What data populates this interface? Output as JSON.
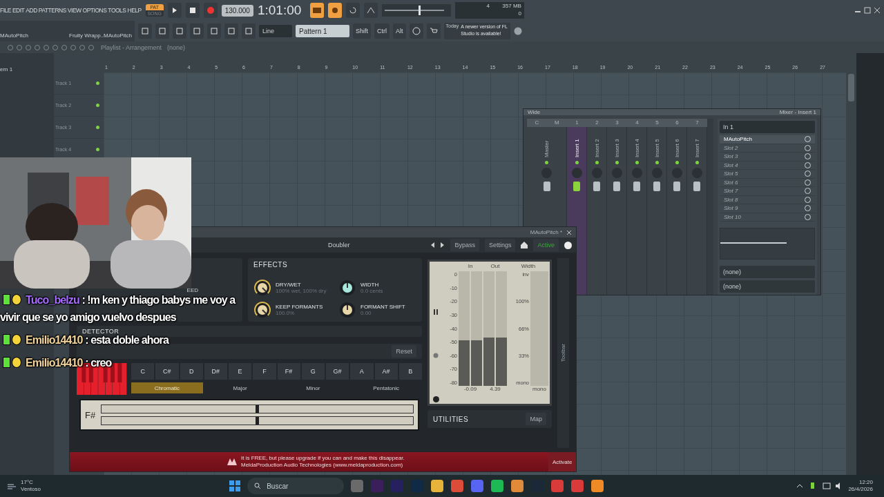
{
  "menu": [
    "FILE",
    "EDIT",
    "ADD",
    "PATTERNS",
    "VIEW",
    "OPTIONS",
    "TOOLS",
    "HELP"
  ],
  "transport": {
    "mode": [
      {
        "label": "PAT",
        "selected": true
      },
      {
        "label": "SONG",
        "selected": false
      }
    ],
    "tempo": "130.000",
    "time": "1:01:00",
    "master_volume": {
      "level": 0.57
    },
    "polyphony": "4",
    "memory": "357 MB",
    "count": "0"
  },
  "hint": {
    "title": "MAutoPitch",
    "detail": "Fruity Wrapp..MAutoPitch"
  },
  "toolbar": {
    "snap": "Line",
    "pattern": "Pattern 1",
    "keys": [
      "Shift",
      "Ctrl",
      "Alt"
    ],
    "news_date": "Today",
    "news": "A newer version of FL Studio is available!"
  },
  "playlist": {
    "title": "Playlist - Arrangement",
    "arrangement": "(none)",
    "picker": "ern 1",
    "ruler": [
      "1",
      "2",
      "3",
      "4",
      "5",
      "6",
      "7",
      "8",
      "9",
      "10",
      "11",
      "12",
      "13",
      "14",
      "15",
      "16",
      "17",
      "18",
      "19",
      "20",
      "21",
      "22",
      "23",
      "24",
      "25",
      "26",
      "27"
    ],
    "tracks": [
      "Track 1",
      "Track 2",
      "Track 3",
      "Track 4"
    ]
  },
  "mixer": {
    "preset": "Wide",
    "title": "Mixer - Insert 1",
    "headers": [
      "C",
      "M",
      "1",
      "2",
      "3",
      "4",
      "5",
      "6",
      "7"
    ],
    "strips": [
      {
        "name": "Master",
        "selected": false
      },
      {
        "name": "Insert 1",
        "selected": true
      },
      {
        "name": "Insert 2",
        "selected": false
      },
      {
        "name": "Insert 3",
        "selected": false
      },
      {
        "name": "Insert 4",
        "selected": false
      },
      {
        "name": "Insert 5",
        "selected": false
      },
      {
        "name": "Insert 6",
        "selected": false
      },
      {
        "name": "Insert 7",
        "selected": false
      }
    ],
    "input": "In 1",
    "slots": [
      {
        "name": "MAutoPitch",
        "disabled": false
      },
      {
        "name": "Slot 2",
        "disabled": true
      },
      {
        "name": "Slot 3",
        "disabled": true
      },
      {
        "name": "Slot 4",
        "disabled": true
      },
      {
        "name": "Slot 5",
        "disabled": true
      },
      {
        "name": "Slot 6",
        "disabled": true
      },
      {
        "name": "Slot 7",
        "disabled": true
      },
      {
        "name": "Slot 8",
        "disabled": true
      },
      {
        "name": "Slot 9",
        "disabled": true
      },
      {
        "name": "Slot 10",
        "disabled": true
      }
    ],
    "outputs": [
      "(none)",
      "(none)"
    ]
  },
  "plugin": {
    "title": "MAutoPitch *",
    "preset": "Doubler",
    "bypass": "Bypass",
    "settings": "Settings",
    "active": "Active",
    "left_label": "EED",
    "effects_title": "EFFECTS",
    "knobs": [
      {
        "label": "DRY/WET",
        "value": "100% wet, 100% dry",
        "kind": "unipolar",
        "color": "#e8d6a8"
      },
      {
        "label": "WIDTH",
        "value": "0.0 cents",
        "kind": "bipolar",
        "color": "#a8e8dc"
      },
      {
        "label": "KEEP FORMANTS",
        "value": "100.0%",
        "kind": "unipolar",
        "color": "#e8d6a8"
      },
      {
        "label": "FORMANT SHIFT",
        "value": "0.00",
        "kind": "bipolar",
        "color": "#e8d6a8"
      }
    ],
    "detector": "DETECTOR",
    "reset": "Reset",
    "notes": [
      "C",
      "C#",
      "D",
      "D#",
      "E",
      "F",
      "F#",
      "G",
      "G#",
      "A",
      "A#",
      "B"
    ],
    "scales": [
      {
        "label": "Chromatic",
        "selected": true
      },
      {
        "label": "Major",
        "selected": false
      },
      {
        "label": "Minor",
        "selected": false
      },
      {
        "label": "Pentatonic",
        "selected": false
      }
    ],
    "note": "F#",
    "meter": {
      "columns": [
        "In",
        "Out",
        "Width"
      ],
      "db_scale": [
        "0",
        "-10",
        "-20",
        "-30",
        "-40",
        "-50",
        "-60",
        "-70",
        "-80"
      ],
      "width_scale": [
        "inv",
        "100%",
        "66%",
        "33%",
        "mono"
      ],
      "channels": [
        {
          "reading": "-0.09",
          "level": 0.4
        },
        {
          "reading": "4.39",
          "level": 0.42
        }
      ],
      "width_reading": "mono"
    },
    "toolbar": "Toolbar",
    "utilities": "UTILITIES",
    "map": "Map",
    "banner": {
      "message": "It is FREE, but please upgrade if you can and make this disappear.",
      "company": "MeldaProduction Audio Technologies (www.meldaproduction.com)",
      "action": "Activate"
    }
  },
  "chat": [
    {
      "user": "Tuco_belzu",
      "color": "#a66cff",
      "text": ": !m ken y thiago babys me voy a vivir que se yo amigo vuelvo despues"
    },
    {
      "user": "Emilio14410",
      "color": "#f2d49a",
      "text": ": esta doble ahora"
    },
    {
      "user": "Emilio14410",
      "color": "#f2d49a",
      "text": ": creo"
    }
  ],
  "taskbar": {
    "temperature": "17°C",
    "condition": "Ventoso",
    "search": "Buscar",
    "time": "12:20",
    "date": "26/4/2026"
  }
}
